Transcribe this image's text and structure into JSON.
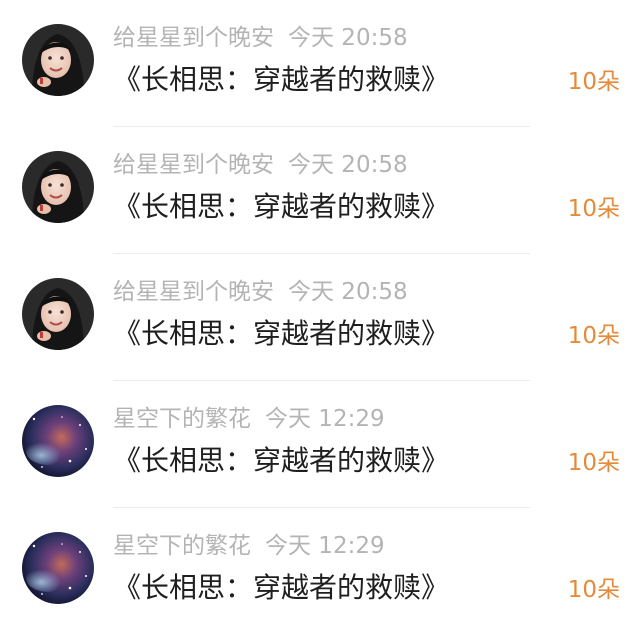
{
  "colors": {
    "meta_text": "#b4b4b4",
    "title_text": "#1f1f1f",
    "amount_text": "#e58a3a",
    "divider": "#ececec"
  },
  "rows": [
    {
      "avatar_icon": "portrait-avatar-icon",
      "username": "给星星到个晚安",
      "time": "今天 20:58",
      "title": "《长相思：穿越者的救赎》",
      "amount": "10朵"
    },
    {
      "avatar_icon": "portrait-avatar-icon",
      "username": "给星星到个晚安",
      "time": "今天 20:58",
      "title": "《长相思：穿越者的救赎》",
      "amount": "10朵"
    },
    {
      "avatar_icon": "portrait-avatar-icon",
      "username": "给星星到个晚安",
      "time": "今天 20:58",
      "title": "《长相思：穿越者的救赎》",
      "amount": "10朵"
    },
    {
      "avatar_icon": "nebula-avatar-icon",
      "username": "星空下的繁花",
      "time": "今天 12:29",
      "title": "《长相思：穿越者的救赎》",
      "amount": "10朵"
    },
    {
      "avatar_icon": "nebula-avatar-icon",
      "username": "星空下的繁花",
      "time": "今天 12:29",
      "title": "《长相思：穿越者的救赎》",
      "amount": "10朵"
    }
  ]
}
